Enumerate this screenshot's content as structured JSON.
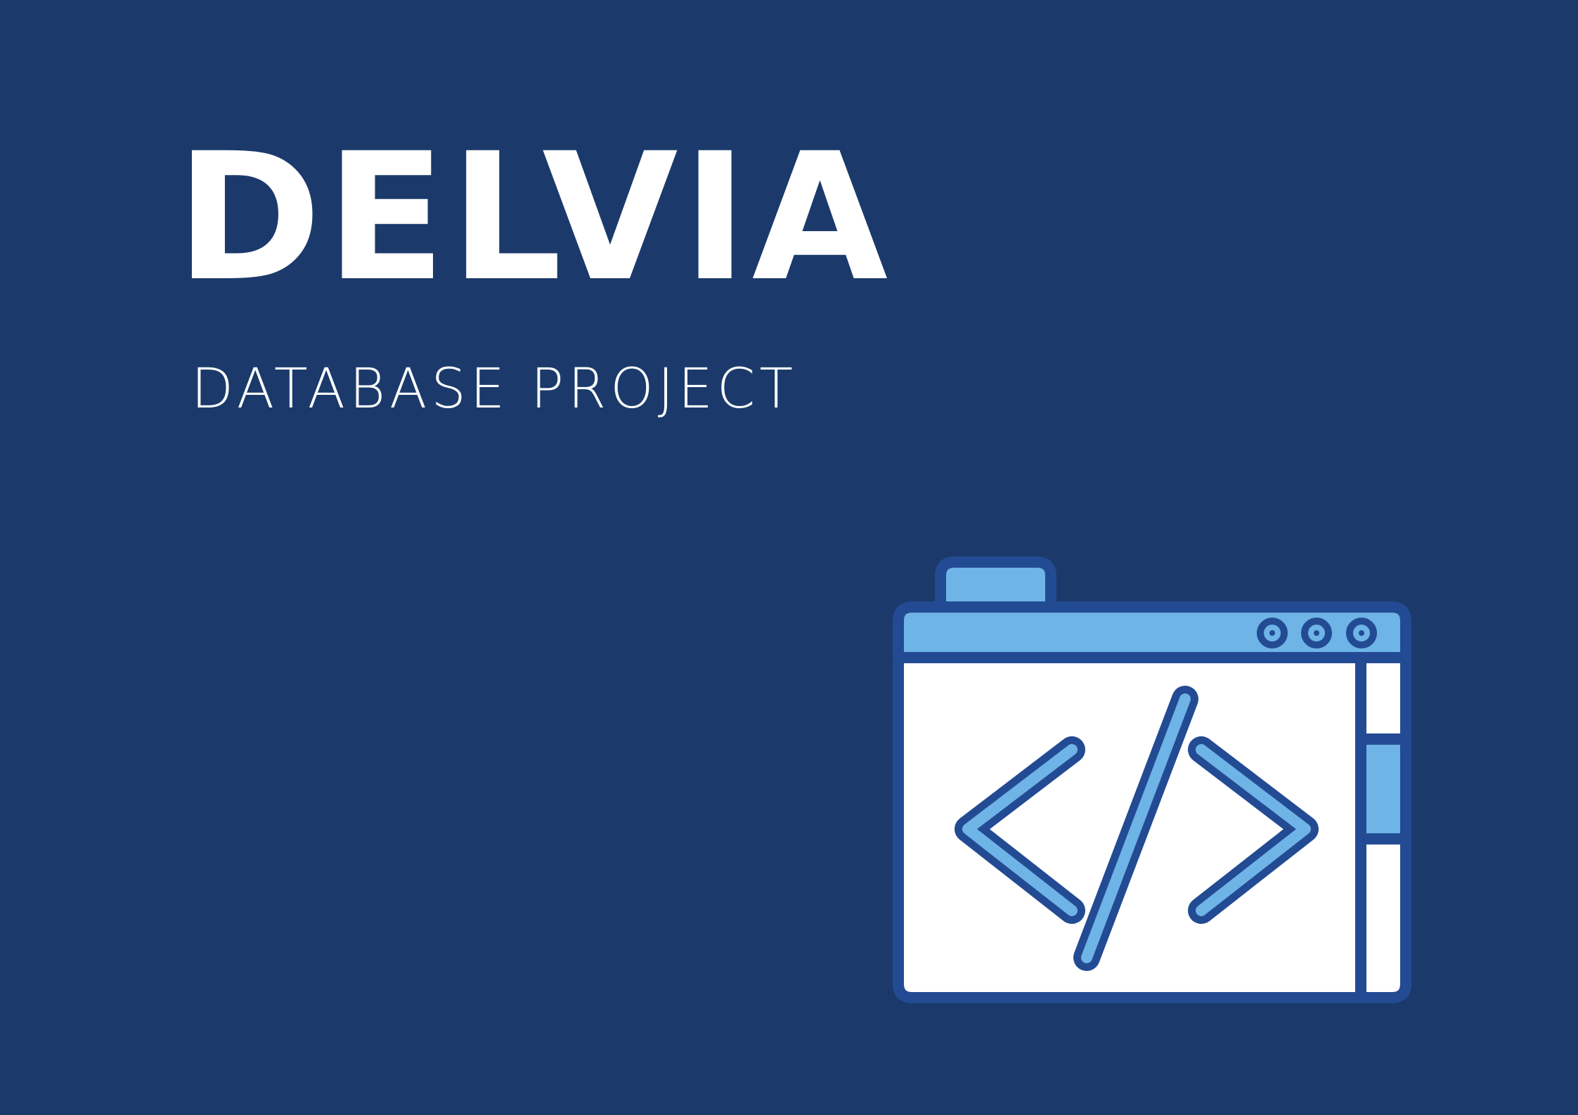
{
  "brand": {
    "title": "DELVIA",
    "subtitle": "DATABASE PROJECT"
  },
  "illustration": {
    "icon": "browser-code-icon",
    "window_dots": 3
  },
  "colors": {
    "background": "#1b3a6b",
    "outline": "#234b93",
    "accent": "#6eb4e6",
    "text": "#ffffff"
  }
}
